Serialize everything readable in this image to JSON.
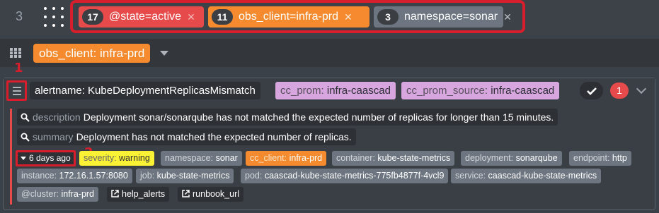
{
  "filter_bar": {
    "counter": "3",
    "filters": [
      {
        "count": "17",
        "label": "@state=active",
        "remove_icon": "close-icon",
        "color": "#e64a4a"
      },
      {
        "count": "11",
        "label": "obs_client=infra-prd",
        "remove_icon": "close-icon",
        "color": "#f68a2e"
      },
      {
        "count": "3",
        "label": "namespace=sonar",
        "remove_icon": "close-icon",
        "color": "#6d7680"
      }
    ]
  },
  "grid": {
    "label_key": "obs_client",
    "label_value": "infra-prd"
  },
  "annotations": {
    "marker_1": "1",
    "marker_2": "2",
    "highlight_color": "#d81e2c"
  },
  "alert_group": {
    "alertname_key": "alertname",
    "alertname_value": "KubeDeploymentReplicasMismatch",
    "labels": [
      {
        "key": "cc_prom",
        "value": "infra-caascad"
      },
      {
        "key": "cc_prom_source",
        "value": "infra-caascad"
      }
    ],
    "alert_count": "1"
  },
  "alert": {
    "annotations": [
      {
        "key": "description",
        "value": "Deployment sonar/sonarqube has not matched the expected number of replicas for longer than 15 minutes."
      },
      {
        "key": "summary",
        "value": "Deployment has not matched the expected number of replicas."
      }
    ],
    "age": "6 days ago",
    "labels_row1": [
      {
        "key": "severity",
        "value": "warning"
      },
      {
        "key": "namespace",
        "value": "sonar"
      },
      {
        "key": "cc_client",
        "value": "infra-prd"
      },
      {
        "key": "container",
        "value": "kube-state-metrics"
      },
      {
        "key": "deployment",
        "value": "sonarqube"
      },
      {
        "key": "endpoint",
        "value": "http"
      }
    ],
    "labels_row2": [
      {
        "key": "instance",
        "value": "172.16.1.57:8080"
      },
      {
        "key": "job",
        "value": "kube-state-metrics"
      },
      {
        "key": "pod",
        "value": "caascad-kube-state-metrics-775fb4877f-4vcl9"
      },
      {
        "key": "service",
        "value": "caascad-kube-state-metrics"
      }
    ],
    "cluster": {
      "key": "@cluster",
      "value": "infra-prd"
    },
    "links": [
      "help_alerts",
      "runbook_url"
    ]
  }
}
